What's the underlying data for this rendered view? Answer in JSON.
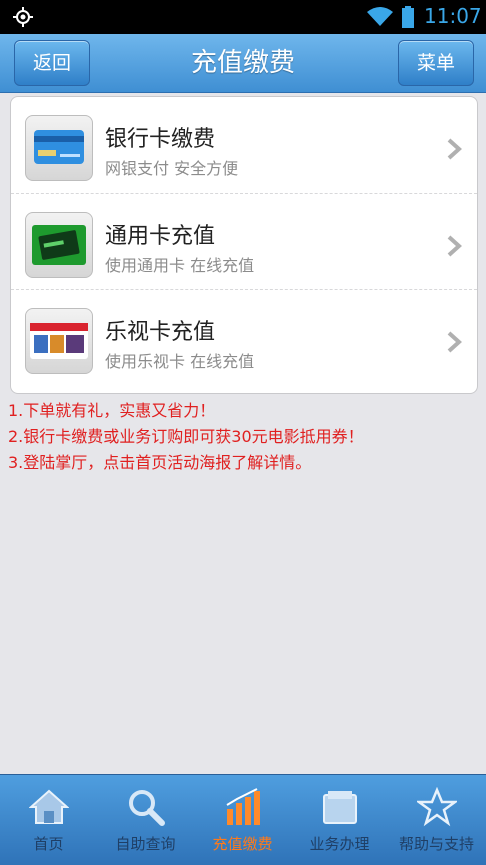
{
  "status_bar": {
    "time": "11:07"
  },
  "header": {
    "back_label": "返回",
    "title": "充值缴费",
    "menu_label": "菜单"
  },
  "list": {
    "items": [
      {
        "title": "银行卡缴费",
        "subtitle": "网银支付 安全方便",
        "icon": "bank-card-icon"
      },
      {
        "title": "通用卡充值",
        "subtitle": "使用通用卡 在线充值",
        "icon": "general-card-icon"
      },
      {
        "title": "乐视卡充值",
        "subtitle": "使用乐视卡 在线充值",
        "icon": "letv-card-icon"
      }
    ]
  },
  "promotions": [
    "1.下单就有礼，实惠又省力！",
    "2.银行卡缴费或业务订购即可获30元电影抵用券！",
    "3.登陆掌厅，点击首页活动海报了解详情。"
  ],
  "nav": {
    "items": [
      {
        "label": "首页",
        "icon": "home-icon",
        "active": false
      },
      {
        "label": "自助查询",
        "icon": "search-icon",
        "active": false
      },
      {
        "label": "充值缴费",
        "icon": "bar-chart-icon",
        "active": true
      },
      {
        "label": "业务办理",
        "icon": "folder-icon",
        "active": false
      },
      {
        "label": "帮助与支持",
        "icon": "star-icon",
        "active": false
      }
    ]
  },
  "colors": {
    "accent": "#3f8fd3",
    "promo_text": "#e02020",
    "active_nav": "#ff7a1a"
  }
}
